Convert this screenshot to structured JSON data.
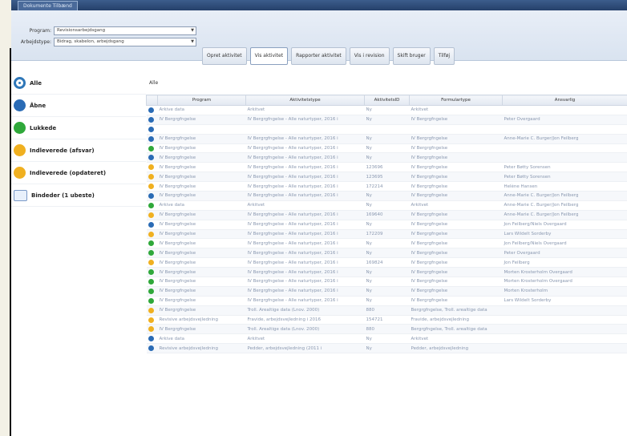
{
  "window": {
    "title": "Dokumente Tilbænd"
  },
  "filters": {
    "program": {
      "label": "Program:",
      "value": "Revisionsarbejdsgang"
    },
    "type": {
      "label": "Arbejdstype:",
      "value": "Bidrag, skabelon, arbejdsgang"
    }
  },
  "toolbar": {
    "buttons": [
      "Opret aktivitet",
      "Vis aktivitet",
      "Rapporter aktivitet",
      "Vis i revision",
      "Skift bruger",
      "Tilføj"
    ]
  },
  "sidebar": {
    "items": [
      {
        "label": "Alle",
        "icon": "alle",
        "icon_name": "all-filter-icon"
      },
      {
        "label": "Åbne",
        "icon": "open",
        "icon_name": "open-status-icon"
      },
      {
        "label": "Lukkede",
        "icon": "closed",
        "icon_name": "closed-status-icon"
      },
      {
        "label": "Indleverede (afsvar)",
        "icon": "pending",
        "icon_name": "submitted-icon"
      },
      {
        "label": "Indleverede (opdateret)",
        "icon": "pending",
        "icon_name": "submitted-updated-icon"
      },
      {
        "label": "Bindeder (1 ubeste)",
        "icon": "draft",
        "icon_name": "draft-icon"
      }
    ]
  },
  "main": {
    "breadcrumb": "Alle",
    "columns": [
      "",
      "Program",
      "Aktivitetstype",
      "AktivitetsID",
      "Formulartype",
      "Ansvarlig"
    ]
  },
  "colors": {
    "open": "#2a6bb5",
    "closed": "#2fa83a",
    "pending": "#f0b020"
  },
  "rows": [
    {
      "status": "open",
      "program": "Arkive data",
      "activity": "Arkitvet",
      "id": "Ny",
      "form": "Arkitvet",
      "owner": ""
    },
    {
      "status": "open",
      "program": "IV Bergrgfngelse",
      "activity": "IV Bergrgfngelse - Alle naturtyper, 2016 i",
      "id": "Ny",
      "form": "IV Bergrgfngelse",
      "owner": "Peter Overgaard"
    },
    {
      "status": "open",
      "program": "",
      "activity": "",
      "id": "",
      "form": "",
      "owner": ""
    },
    {
      "status": "open",
      "program": "IV Bergrgfngelse",
      "activity": "IV Bergrgfngelse - Alle naturtyper, 2016 i",
      "id": "Ny",
      "form": "IV Bergrgfngelse",
      "owner": "Anne-Marie C. Burger/Jon Feilberg"
    },
    {
      "status": "closed",
      "program": "IV Bergrgfngelse",
      "activity": "IV Bergrgfngelse - Alle naturtyper, 2016 i",
      "id": "Ny",
      "form": "IV Bergrgfngelse",
      "owner": ""
    },
    {
      "status": "open",
      "program": "IV Bergrgfngelse",
      "activity": "IV Bergrgfngelse - Alle naturtyper, 2016 i",
      "id": "Ny",
      "form": "IV Bergrgfngelse",
      "owner": ""
    },
    {
      "status": "pending",
      "program": "IV Bergrgfngelse",
      "activity": "IV Bergrgfngelse - Alle naturtyper, 2016 i",
      "id": "123696",
      "form": "IV Bergrgfngelse",
      "owner": "Peter Bøtty Sorensen"
    },
    {
      "status": "pending",
      "program": "IV Bergrgfngelse",
      "activity": "IV Bergrgfngelse - Alle naturtyper, 2016 i",
      "id": "123695",
      "form": "IV Bergrgfngelse",
      "owner": "Peter Bøtty Sorensen"
    },
    {
      "status": "pending",
      "program": "IV Bergrgfngelse",
      "activity": "IV Bergrgfngelse - Alle naturtyper, 2016 i",
      "id": "172214",
      "form": "IV Bergrgfngelse",
      "owner": "Helène Hansen"
    },
    {
      "status": "open",
      "program": "IV Bergrgfngelse",
      "activity": "IV Bergrgfngelse - Alle naturtyper, 2016 i",
      "id": "Ny",
      "form": "IV Bergrgfngelse",
      "owner": "Anne-Marie C. Burger/Jon Feilberg"
    },
    {
      "status": "closed",
      "program": "Arkive data",
      "activity": "Arkitvet",
      "id": "Ny",
      "form": "Arkitvet",
      "owner": "Anne-Marie C. Burger/Jon Feilberg"
    },
    {
      "status": "pending",
      "program": "IV Bergrgfngelse",
      "activity": "IV Bergrgfngelse - Alle naturtyper, 2016 i",
      "id": "169640",
      "form": "IV Bergrgfngelse",
      "owner": "Anne-Marie C. Burger/Jon Feilberg"
    },
    {
      "status": "open",
      "program": "IV Bergrgfngelse",
      "activity": "IV Bergrgfngelse - Alle naturtyper, 2016 i",
      "id": "Ny",
      "form": "IV Bergrgfngelse",
      "owner": "Jon Feilberg/Niels Overgaard"
    },
    {
      "status": "pending",
      "program": "IV Bergrgfngelse",
      "activity": "IV Bergrgfngelse - Alle naturtyper, 2016 i",
      "id": "172209",
      "form": "IV Bergrgfngelse",
      "owner": "Lars Wildelt Sorderby"
    },
    {
      "status": "closed",
      "program": "IV Bergrgfngelse",
      "activity": "IV Bergrgfngelse - Alle naturtyper, 2016 i",
      "id": "Ny",
      "form": "IV Bergrgfngelse",
      "owner": "Jon Feilberg/Niels Overgaard"
    },
    {
      "status": "closed",
      "program": "IV Bergrgfngelse",
      "activity": "IV Bergrgfngelse - Alle naturtyper, 2016 i",
      "id": "Ny",
      "form": "IV Bergrgfngelse",
      "owner": "Peter Overgaard"
    },
    {
      "status": "pending",
      "program": "IV Bergrgfngelse",
      "activity": "IV Bergrgfngelse - Alle naturtyper, 2016 i",
      "id": "169824",
      "form": "IV Bergrgfngelse",
      "owner": "Jon Feilberg"
    },
    {
      "status": "closed",
      "program": "IV Bergrgfngelse",
      "activity": "IV Bergrgfngelse - Alle naturtyper, 2016 i",
      "id": "Ny",
      "form": "IV Bergrgfngelse",
      "owner": "Morten Krosterholm Overgaard"
    },
    {
      "status": "closed",
      "program": "IV Bergrgfngelse",
      "activity": "IV Bergrgfngelse - Alle naturtyper, 2016 i",
      "id": "Ny",
      "form": "IV Bergrgfngelse",
      "owner": "Morten Krosterholm Overgaard"
    },
    {
      "status": "closed",
      "program": "IV Bergrgfngelse",
      "activity": "IV Bergrgfngelse - Alle naturtyper, 2016 i",
      "id": "Ny",
      "form": "IV Bergrgfngelse",
      "owner": "Morten Krosterholm"
    },
    {
      "status": "closed",
      "program": "IV Bergrgfngelse",
      "activity": "IV Bergrgfngelse - Alle naturtyper, 2016 i",
      "id": "Ny",
      "form": "IV Bergrgfngelse",
      "owner": "Lars Wildelt Sorderby"
    },
    {
      "status": "pending",
      "program": "IV Bergrgfngelse",
      "activity": "Troll. Arealtige data (Lnov. 2000)",
      "id": "880",
      "form": "Bergrgfngelse, Troll. arealtige data",
      "owner": ""
    },
    {
      "status": "pending",
      "program": "Revisive arbejdsvejledning",
      "activity": "Fravide, arbejdsvejledning i 2016",
      "id": "154721",
      "form": "Fravide, arbejdsvejledning",
      "owner": ""
    },
    {
      "status": "pending",
      "program": "IV Bergrgfngelse",
      "activity": "Troll. Arealtige data (Lnov. 2000)",
      "id": "880",
      "form": "Bergrgfngelse, Troll. arealtige data",
      "owner": ""
    },
    {
      "status": "open",
      "program": "Arkive data",
      "activity": "Arkitvet",
      "id": "Ny",
      "form": "Arkitvet",
      "owner": ""
    },
    {
      "status": "open",
      "program": "Revisive arbejdsvejledning",
      "activity": "Pedder, arbejdsvejledning (2011 i",
      "id": "Ny",
      "form": "Pedder, arbejdsvejledning",
      "owner": ""
    }
  ]
}
